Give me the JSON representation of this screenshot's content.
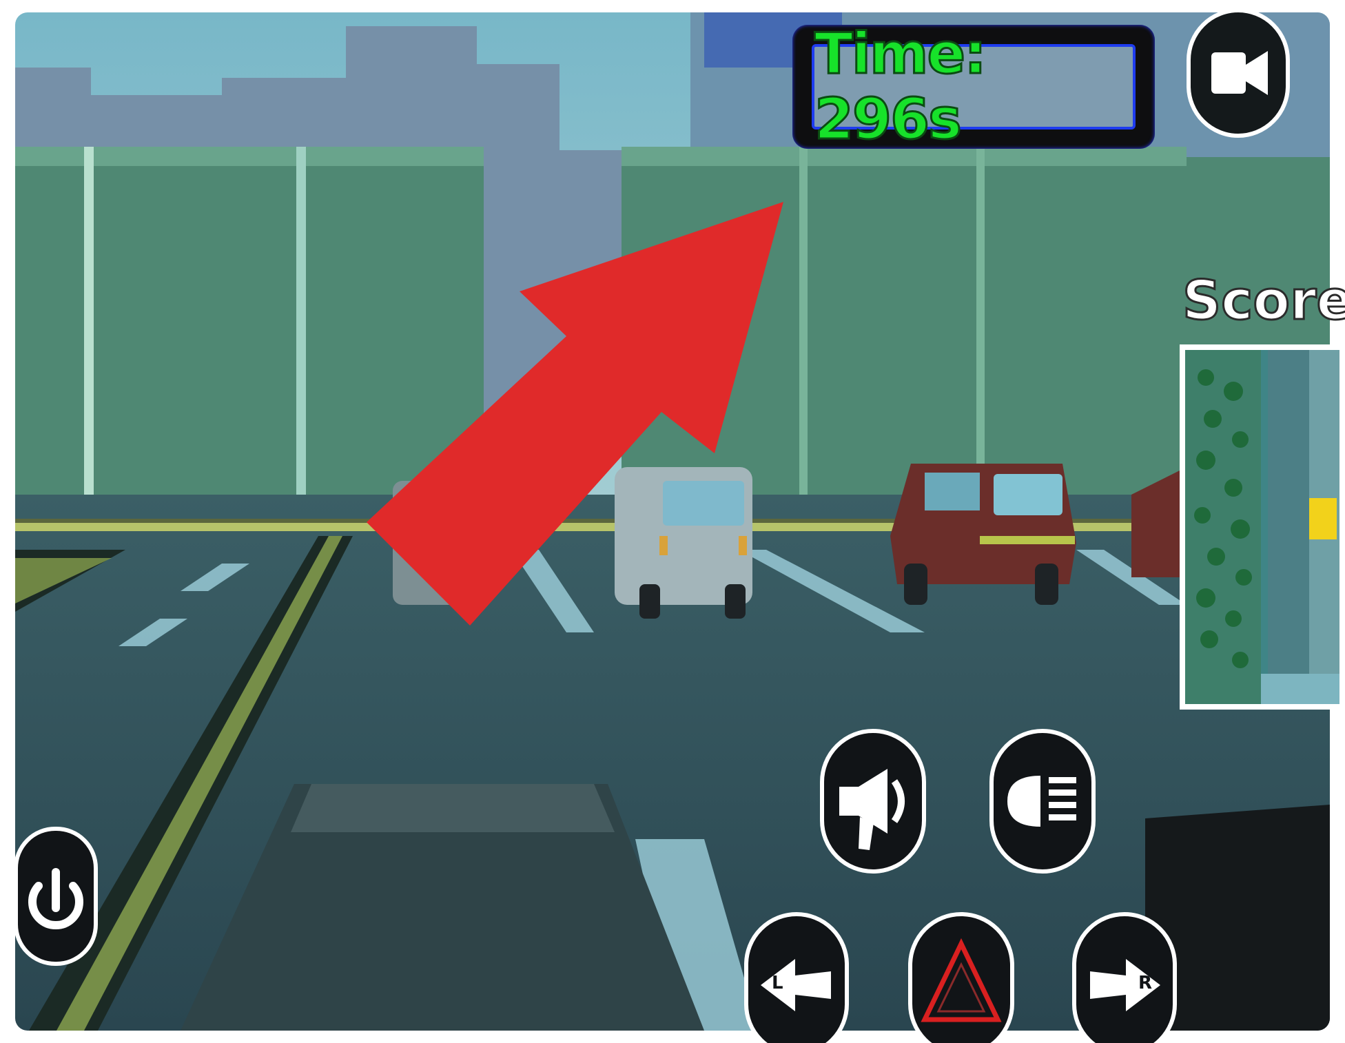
{
  "hud": {
    "timer_label": "Time: 296s",
    "score_label": "Score:"
  },
  "icons": {
    "camera": "video-camera-icon",
    "power": "power-icon",
    "horn": "megaphone-horn-icon",
    "headlights": "headlight-icon",
    "left_indicator": "left-arrow-indicator-icon",
    "hazard": "hazard-triangle-icon",
    "right_indicator": "right-arrow-indicator-icon"
  },
  "controls": {
    "left_letter": "L",
    "right_letter": "R"
  },
  "colors": {
    "timer_green": "#17e22a",
    "arrow_red": "#e02a2a",
    "hud_border_blue": "#1e3cf0",
    "button_dark": "#111417",
    "hazard_red": "#d92020"
  }
}
